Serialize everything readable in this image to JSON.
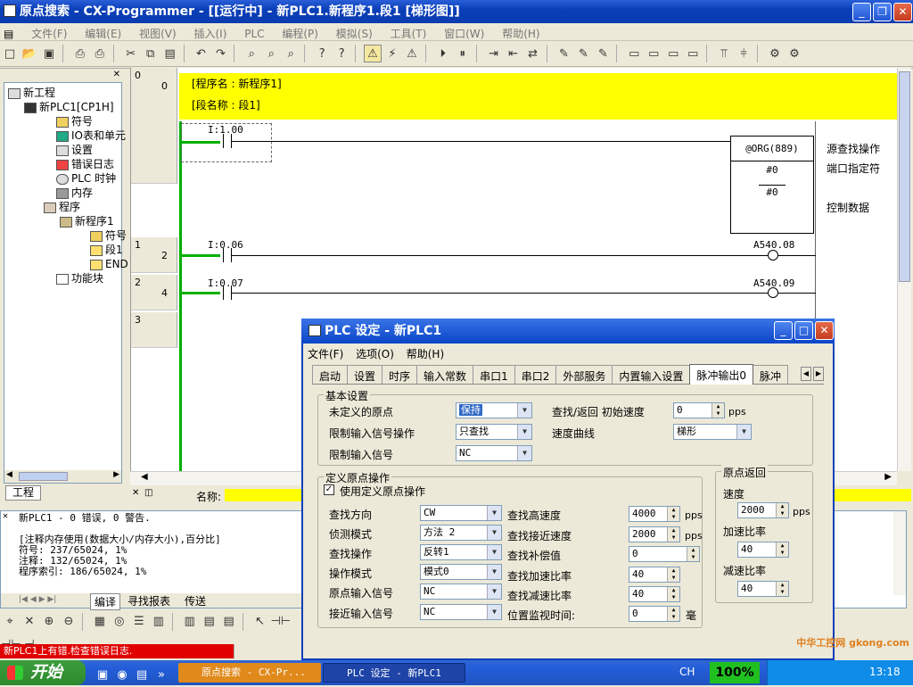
{
  "window": {
    "title": "原点搜索 - CX-Programmer - [[运行中] - 新PLC1.新程序1.段1 [梯形图]]"
  },
  "menu": [
    "文件(F)",
    "编辑(E)",
    "视图(V)",
    "插入(I)",
    "PLC",
    "编程(P)",
    "模拟(S)",
    "工具(T)",
    "窗口(W)",
    "帮助(H)"
  ],
  "tree": {
    "items": [
      {
        "label": "新工程",
        "icon": "project-icon"
      },
      {
        "label": "新PLC1[CP1H]",
        "icon": "plc-icon"
      },
      {
        "label": "符号",
        "icon": "symbols-icon"
      },
      {
        "label": "IO表和单元",
        "icon": "io-table-icon"
      },
      {
        "label": "设置",
        "icon": "settings-icon"
      },
      {
        "label": "错误日志",
        "icon": "error-log-icon"
      },
      {
        "label": "PLC 时钟",
        "icon": "clock-icon"
      },
      {
        "label": "内存",
        "icon": "memory-icon"
      },
      {
        "label": "程序",
        "icon": "programs-icon"
      },
      {
        "label": "新程序1",
        "icon": "program-icon"
      },
      {
        "label": "符号",
        "icon": "symbols-icon"
      },
      {
        "label": "段1",
        "icon": "section-icon"
      },
      {
        "label": "END",
        "icon": "section-icon"
      },
      {
        "label": "功能块",
        "icon": "function-block-icon"
      }
    ],
    "tab": "工程"
  },
  "ladder": {
    "program_name": "[程序名 : 新程序1]",
    "section_name": "[段名称 : 段1]",
    "rungs": [
      {
        "num": "0",
        "step": "0"
      },
      {
        "num": "1",
        "step": "2"
      },
      {
        "num": "2",
        "step": "4"
      },
      {
        "num": "3",
        "step": ""
      }
    ],
    "contacts": [
      "I:1.00",
      "I:0.06",
      "I:0.07"
    ],
    "coils": [
      "A540.08",
      "A540.09"
    ],
    "instruction": {
      "name": "@ORG(889)",
      "op1": "#0",
      "op2": "#0"
    },
    "comments": [
      "源查找操作",
      "端口指定符",
      "控制数据"
    ],
    "name_label": "名称:"
  },
  "output": {
    "lines": [
      "新PLC1 - 0 错误, 0 警告.",
      "",
      "[注释内存使用(数据大小/内存大小),百分比]",
      "符号: 237/65024, 1%",
      "注释: 132/65024, 1%",
      "程序索引: 186/65024, 1%"
    ],
    "tabs": [
      "编译",
      "寻找报表",
      "传送"
    ]
  },
  "status": {
    "error_text": "新PLC1上有错.检查错误日志."
  },
  "dialog": {
    "title": "PLC 设定 - 新PLC1",
    "menu": [
      "文件(F)",
      "选项(O)",
      "帮助(H)"
    ],
    "tabs": [
      "启动",
      "设置",
      "时序",
      "输入常数",
      "串口1",
      "串口2",
      "外部服务",
      "内置输入设置",
      "脉冲输出0",
      "脉冲"
    ],
    "active_tab": "脉冲输出0",
    "basic": {
      "title": "基本设置",
      "undefined_origin_label": "未定义的原点",
      "undefined_origin_value": "保持",
      "limit_op_label": "限制输入信号操作",
      "limit_op_value": "只查找",
      "limit_sig_label": "限制输入信号",
      "limit_sig_value": "NC",
      "init_speed_label": "查找/返回 初始速度",
      "init_speed_value": "0",
      "init_speed_unit": "pps",
      "curve_label": "速度曲线",
      "curve_value": "梯形"
    },
    "origin": {
      "title": "定义原点操作",
      "use_label": "使用定义原点操作",
      "dir_label": "查找方向",
      "dir_value": "CW",
      "detect_label": "侦测模式",
      "detect_value": "方法 2",
      "search_op_label": "查找操作",
      "search_op_value": "反转1",
      "op_mode_label": "操作模式",
      "op_mode_value": "模式0",
      "origin_sig_label": "原点输入信号",
      "origin_sig_value": "NC",
      "prox_sig_label": "接近输入信号",
      "prox_sig_value": "NC",
      "high_speed_label": "查找高速度",
      "high_speed_value": "4000",
      "prox_speed_label": "查找接近速度",
      "prox_speed_value": "2000",
      "comp_label": "查找补偿值",
      "comp_value": "0",
      "acc_label": "查找加速比率",
      "acc_value": "40",
      "dec_label": "查找减速比率",
      "dec_value": "40",
      "monitor_label": "位置监视时间:",
      "monitor_value": "0",
      "monitor_unit": "毫",
      "pps": "pps"
    },
    "return": {
      "title": "原点返回",
      "speed_label": "速度",
      "speed_value": "2000",
      "speed_unit": "pps",
      "acc_label": "加速比率",
      "acc_value": "40",
      "dec_label": "减速比率",
      "dec_value": "40"
    }
  },
  "taskbar": {
    "start": "开始",
    "tasks": [
      "原点搜索 - CX-Pr...",
      "PLC 设定 - 新PLC1"
    ],
    "zoom": "100%",
    "ime": "CH",
    "clock": "13:18",
    "watermark": "中华工控网 gkong.com"
  }
}
